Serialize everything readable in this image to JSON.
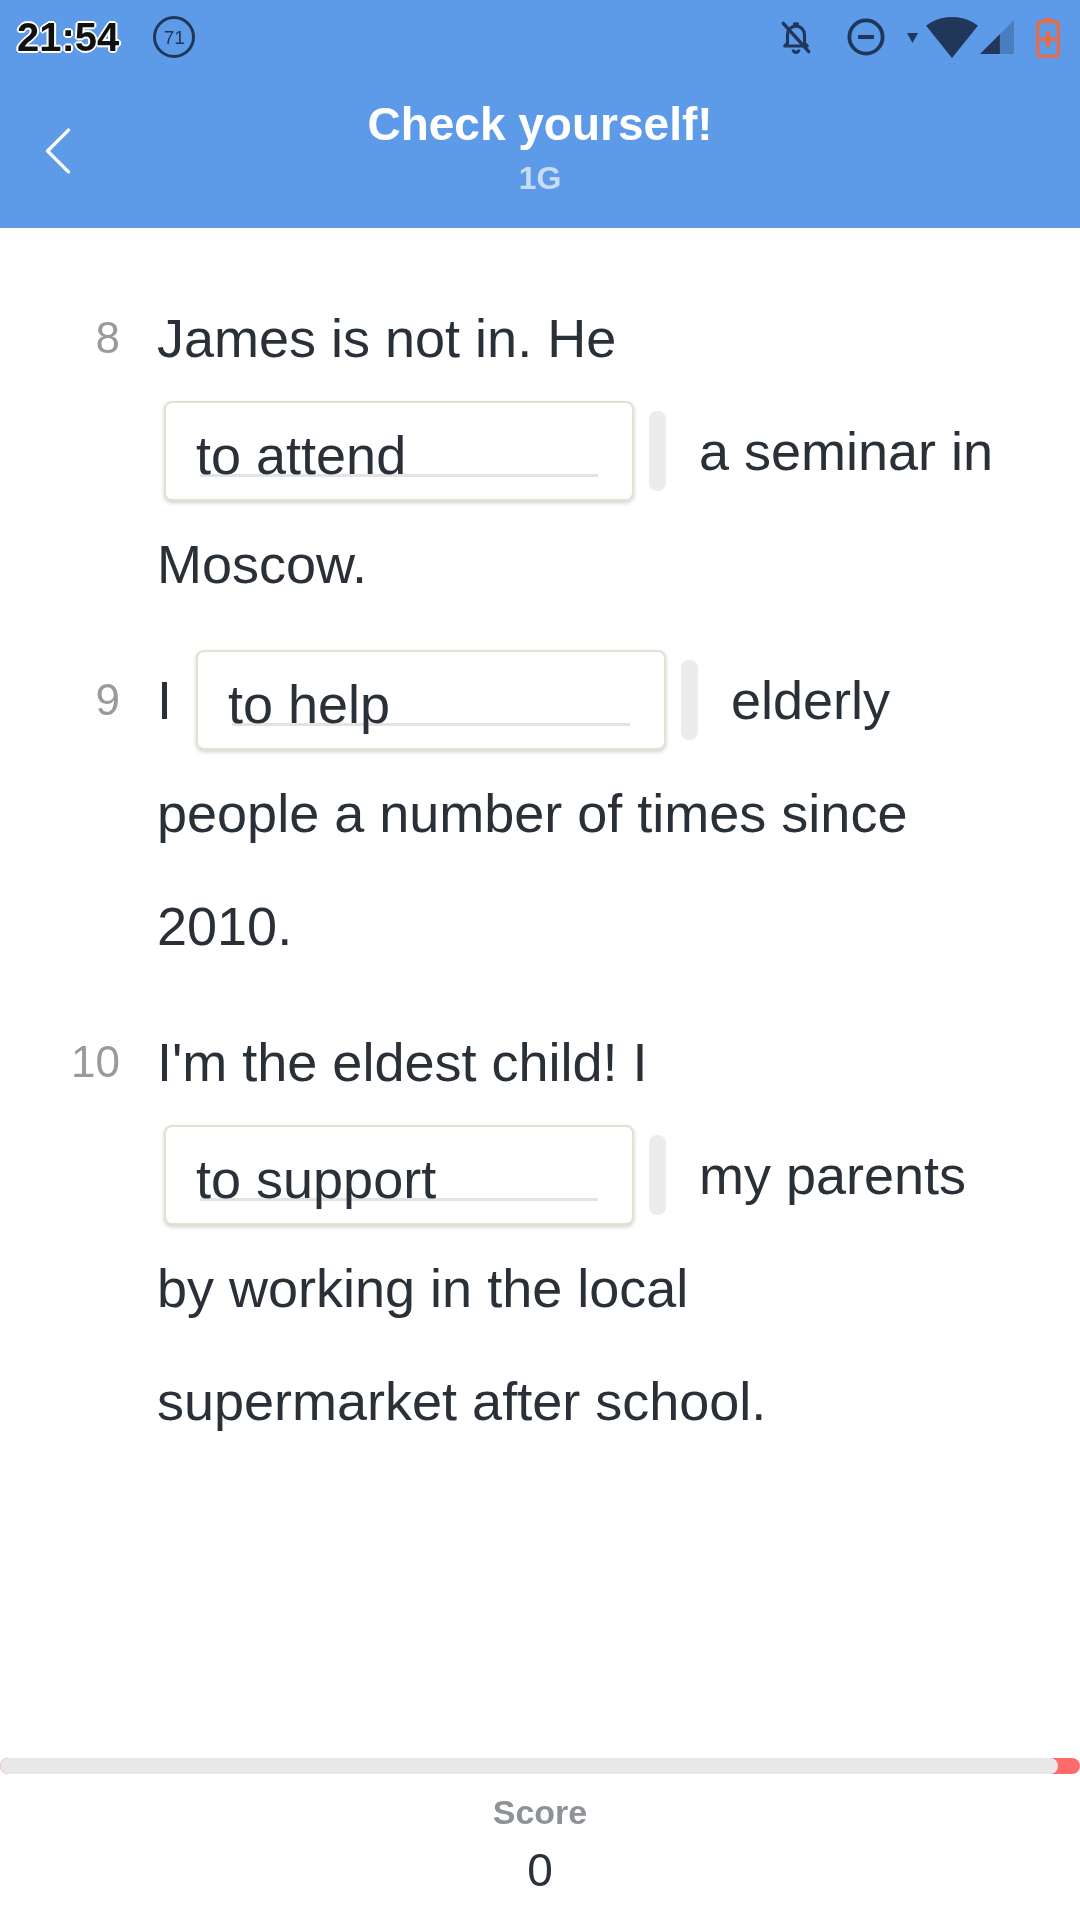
{
  "status_bar": {
    "time": "21:54",
    "badge": "71"
  },
  "header": {
    "title": "Check yourself!",
    "subtitle": "1G"
  },
  "questions": [
    {
      "number": "8",
      "lines": [
        [
          {
            "kind": "text",
            "text": "James is not in. He"
          }
        ],
        [
          {
            "kind": "blank",
            "value": "to attend"
          },
          {
            "kind": "text",
            "text": "a seminar in"
          }
        ],
        [
          {
            "kind": "text",
            "text": "Moscow."
          }
        ]
      ]
    },
    {
      "number": "9",
      "lines": [
        [
          {
            "kind": "text",
            "text": "I"
          },
          {
            "kind": "blank",
            "value": "to help"
          },
          {
            "kind": "text",
            "text": "elderly"
          }
        ],
        [
          {
            "kind": "text",
            "text": "people a number of times since"
          }
        ],
        [
          {
            "kind": "text",
            "text": "2010."
          }
        ]
      ]
    },
    {
      "number": "10",
      "lines": [
        [
          {
            "kind": "text",
            "text": "I'm the eldest child! I"
          }
        ],
        [
          {
            "kind": "blank",
            "value": "to support"
          },
          {
            "kind": "text",
            "text": "my parents"
          }
        ],
        [
          {
            "kind": "text",
            "text": "by working in the local"
          }
        ],
        [
          {
            "kind": "text",
            "text": "supermarket after school."
          }
        ]
      ]
    }
  ],
  "progress": {
    "level": 0.98
  },
  "score": {
    "label": "Score",
    "value": "0"
  }
}
